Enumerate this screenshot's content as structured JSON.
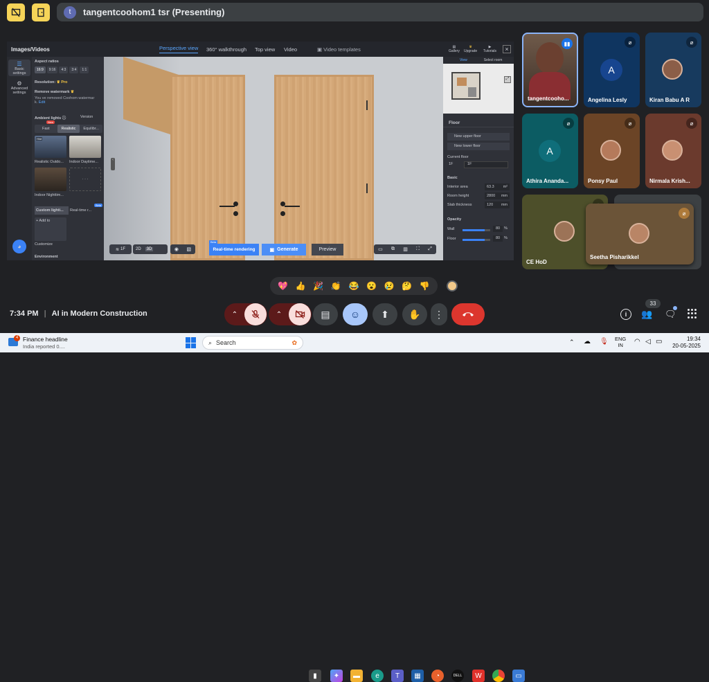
{
  "meeting": {
    "title": "tangentcoohom1 tsr (Presenting)",
    "avatar_letter": "t",
    "time": "7:34 PM",
    "separator": "|",
    "name": "AI in Modern Construction",
    "participants_badge": "33"
  },
  "app": {
    "left_title": "Images/Videos",
    "tabs": [
      "Perspective view",
      "360° walkthrough",
      "Top view",
      "Video"
    ],
    "video_templates": "Video templates",
    "top_icons": [
      "Gallery",
      "Upgrade",
      "Tutorials"
    ],
    "close": "×",
    "sidebar": [
      "Basic settings",
      "Advanced settings"
    ],
    "aspect_label": "Aspect ratios",
    "aspects": [
      "16:9",
      "9:16",
      "4:3",
      "3:4",
      "1:1"
    ],
    "resolution_label": "Resolution:",
    "pro": "Pro",
    "remove_wm": "Remove watermark",
    "wm_text_1": "You   ve removed Coohom watermar",
    "wm_text_2": "k.",
    "edit": "Edit",
    "ambient_label": "Ambient lights",
    "version": "Version",
    "new_badge": "New",
    "light_modes": [
      "Fast",
      "Realistic",
      "Equilibr..."
    ],
    "thumb_labels": [
      "Realistic Outdo...",
      "Indoor Daytime...",
      "Indoor Nighttim..."
    ],
    "no_longer": "Hint",
    "custom_tabs": [
      "Custom lighti...",
      "Real-time r..."
    ],
    "add_to": "+ Add to",
    "customize": "Customize",
    "environment": "Environment",
    "bottom_left": [
      "1F",
      "2D",
      "3D"
    ],
    "realtime": "Real-time rendering",
    "generate": "Generate",
    "preview": "Preview",
    "beta": "Beta",
    "view_tab": "View",
    "select_room": "Select room",
    "floor_title": "Floor",
    "new_upper": "New upper floor",
    "new_lower": "New lower floor",
    "current_floor": "Current floor",
    "floor_num": "1F",
    "floor_idx": "1F",
    "basic": "Basic",
    "interior_area": "Interior area",
    "interior_area_val": "63.3",
    "interior_area_unit": "m²",
    "room_height": "Room height",
    "room_height_val": "2800",
    "room_height_unit": "mm",
    "slab": "Slab thickness",
    "slab_val": "120",
    "slab_unit": "mm",
    "opacity": "Opacity",
    "wall": "Wall",
    "wall_val": "80",
    "wall_pct": 0.8,
    "floor_lbl": "Floor",
    "floor_val": "80",
    "floor_pct": 0.8,
    "pct": "%"
  },
  "participants": [
    {
      "name": "tangentcooho...",
      "type": "video"
    },
    {
      "name": "Angelina Lesly",
      "letter": "A",
      "color": "#17458f"
    },
    {
      "name": "Kiran Babu A R",
      "type": "photo"
    },
    {
      "name": "Athira Ananda...",
      "letter": "A",
      "color": "#0f6e7a"
    },
    {
      "name": "Ponsy Paul",
      "type": "photo"
    },
    {
      "name": "Nirmala Krish...",
      "type": "photo"
    },
    {
      "name": "CE HoD",
      "type": "photo"
    },
    {
      "name": "Seetha Pisharikkel",
      "type": "photo"
    }
  ],
  "reactions": [
    "💖",
    "👍",
    "🎉",
    "👏",
    "😂",
    "😮",
    "😢",
    "🤔",
    "👎"
  ],
  "taskbar": {
    "news_title": "Finance headline",
    "news_sub": "India reported 0....",
    "news_badge": "4",
    "search": "Search",
    "lang1": "ENG",
    "lang2": "IN",
    "clock": "19:34",
    "date": "20-05-2025"
  }
}
